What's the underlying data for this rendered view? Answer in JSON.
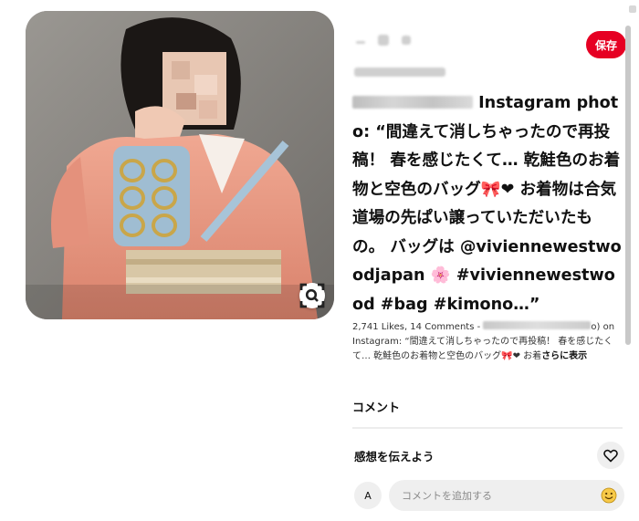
{
  "actions": {
    "save_label": "保存",
    "icons": [
      "more-icon",
      "share-icon",
      "link-icon"
    ]
  },
  "pin": {
    "title_suffix": "Instagram photo: “間違えて消しちゃったので再投稿！ 春を感じたくて… 乾鮭色のお着物と空色のバッグ🎀❤ お着物は合気道場の先ぱい譲っていただいたもの。 バッグは @viviennewestwoodjapan 🌸 #viviennewestwood #bag #kimono…”",
    "description_prefix": "2,741 Likes, 14 Comments - ",
    "description_handle_tail": "o) on",
    "description_body": "Instagram: “間違えて消しちゃったので再投稿！ 春を感じたくて… 乾鮭色のお着物と空色のバッグ🎀❤ お着",
    "show_more": "さらに表示"
  },
  "comments": {
    "heading": "コメント",
    "reaction_prompt": "感想を伝えよう",
    "avatar_initial": "A",
    "placeholder": "コメントを追加する"
  },
  "colors": {
    "accent": "#e60023",
    "field_bg": "#efefef",
    "kimono": "#e89a84",
    "bag": "#9fbdd2"
  }
}
